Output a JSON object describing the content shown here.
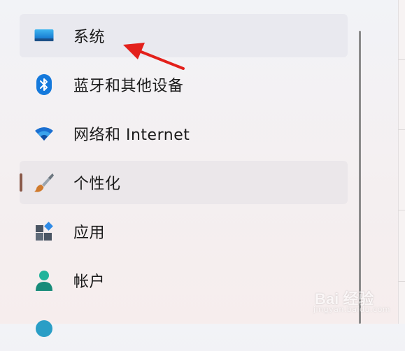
{
  "nav": {
    "items": [
      {
        "label": "系统",
        "icon": "display-icon"
      },
      {
        "label": "蓝牙和其他设备",
        "icon": "bluetooth-icon"
      },
      {
        "label": "网络和 Internet",
        "icon": "wifi-icon"
      },
      {
        "label": "个性化",
        "icon": "paintbrush-icon"
      },
      {
        "label": "应用",
        "icon": "apps-icon"
      },
      {
        "label": "帐户",
        "icon": "account-icon"
      }
    ]
  },
  "watermark": {
    "text": "Bai 经验",
    "sub": "jingyan.baidu.com"
  },
  "colors": {
    "accent": "#8a5a4a",
    "arrow": "#e3201b",
    "selected_bg": "#e9e9ef"
  }
}
